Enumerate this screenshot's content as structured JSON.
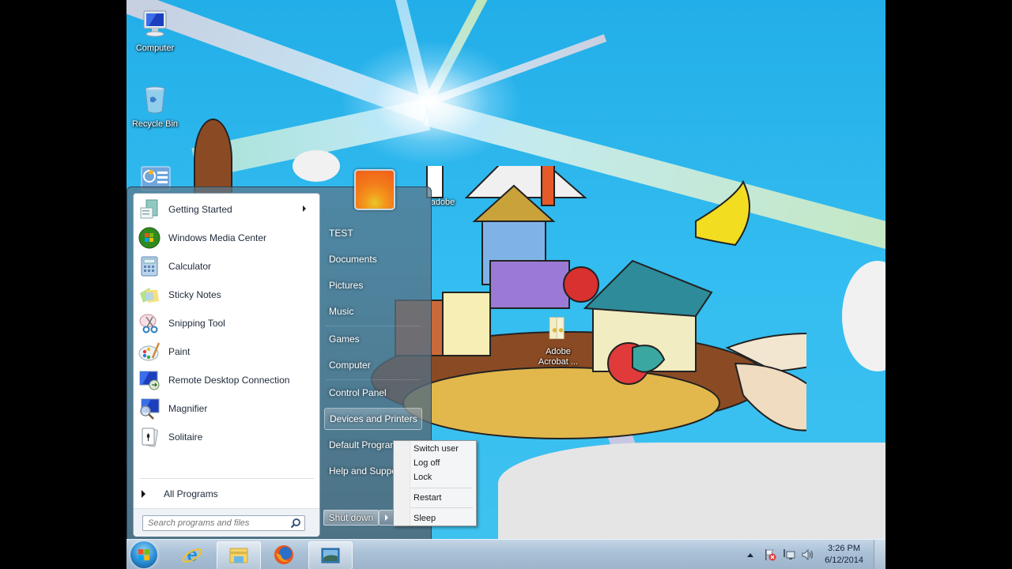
{
  "desktop": {
    "icons": [
      {
        "label": "Computer",
        "icon": "computer-icon"
      },
      {
        "label": "Recycle Bin",
        "icon": "recycle-bin-icon"
      },
      {
        "label": "",
        "icon": "gadget-icon"
      },
      {
        "label": "adobe",
        "icon": "folder-icon"
      },
      {
        "label": "Adobe Acrobat ...",
        "icon": "acrobat-icon"
      }
    ]
  },
  "start_menu": {
    "programs": [
      {
        "label": "Getting Started",
        "icon": "getting-started-icon",
        "has_submenu": true
      },
      {
        "label": "Windows Media Center",
        "icon": "windows-media-center-icon"
      },
      {
        "label": "Calculator",
        "icon": "calculator-icon"
      },
      {
        "label": "Sticky Notes",
        "icon": "sticky-notes-icon"
      },
      {
        "label": "Snipping Tool",
        "icon": "snipping-tool-icon"
      },
      {
        "label": "Paint",
        "icon": "paint-icon"
      },
      {
        "label": "Remote Desktop Connection",
        "icon": "remote-desktop-icon"
      },
      {
        "label": "Magnifier",
        "icon": "magnifier-icon"
      },
      {
        "label": "Solitaire",
        "icon": "solitaire-icon"
      }
    ],
    "all_programs_label": "All Programs",
    "search_placeholder": "Search programs and files",
    "right_items": [
      {
        "label": "TEST"
      },
      {
        "label": "Documents"
      },
      {
        "label": "Pictures"
      },
      {
        "label": "Music"
      },
      {
        "label": "Games"
      },
      {
        "label": "Computer"
      },
      {
        "label": "Control Panel"
      },
      {
        "label": "Devices and Printers",
        "highlighted": true
      },
      {
        "label": "Default Programs"
      },
      {
        "label": "Help and Support"
      }
    ],
    "shutdown_label": "Shut down",
    "power_menu": [
      {
        "label": "Switch user"
      },
      {
        "label": "Log off"
      },
      {
        "label": "Lock"
      },
      {
        "label": "Restart"
      },
      {
        "label": "Sleep"
      }
    ]
  },
  "taskbar": {
    "pinned": [
      {
        "name": "internet-explorer",
        "icon": "internet-explorer-icon"
      },
      {
        "name": "windows-explorer",
        "icon": "folder-icon",
        "active": true
      },
      {
        "name": "firefox",
        "icon": "firefox-icon"
      },
      {
        "name": "picture-viewer",
        "icon": "picture-viewer-icon",
        "active": true
      }
    ],
    "tray": {
      "time": "3:26 PM",
      "date": "6/12/2014"
    }
  }
}
